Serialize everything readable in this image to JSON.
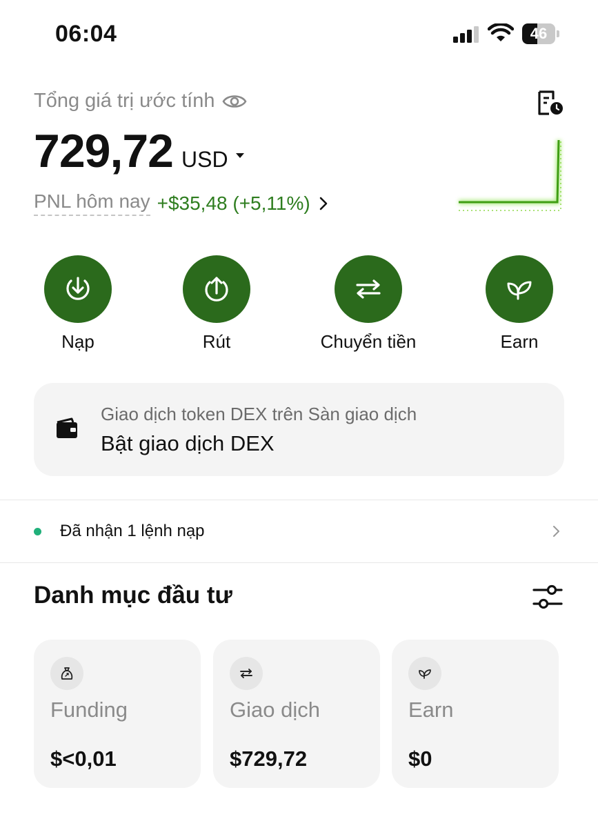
{
  "status_bar": {
    "time": "06:04",
    "battery_level": "46"
  },
  "balance": {
    "label": "Tổng giá trị ước tính",
    "amount": "729,72",
    "currency": "USD",
    "pnl_label": "PNL hôm nay",
    "pnl_value": "+$35,48 (+5,11%)"
  },
  "actions": [
    {
      "label": "Nạp",
      "icon": "deposit-icon"
    },
    {
      "label": "Rút",
      "icon": "withdraw-icon"
    },
    {
      "label": "Chuyển tiền",
      "icon": "transfer-icon"
    },
    {
      "label": "Earn",
      "icon": "earn-leaf-icon"
    }
  ],
  "dex_card": {
    "subtitle": "Giao dịch token DEX trên Sàn giao dịch",
    "title": "Bật giao dịch DEX",
    "icon": "wallet-icon"
  },
  "notice": {
    "text": "Đã nhận 1 lệnh nạp"
  },
  "portfolio": {
    "title": "Danh mục đầu tư",
    "cards": [
      {
        "name": "Funding",
        "value": "$<0,01",
        "icon": "funding-bag-icon"
      },
      {
        "name": "Giao dịch",
        "value": "$729,72",
        "icon": "trading-arrows-icon"
      },
      {
        "name": "Earn",
        "value": "$0",
        "icon": "earn-leaf-icon"
      }
    ]
  },
  "colors": {
    "brand_green": "#2b6a1c",
    "pnl_green": "#2e7d1f",
    "spark_green": "#6bd81c",
    "notice_dot": "#20b07a"
  }
}
